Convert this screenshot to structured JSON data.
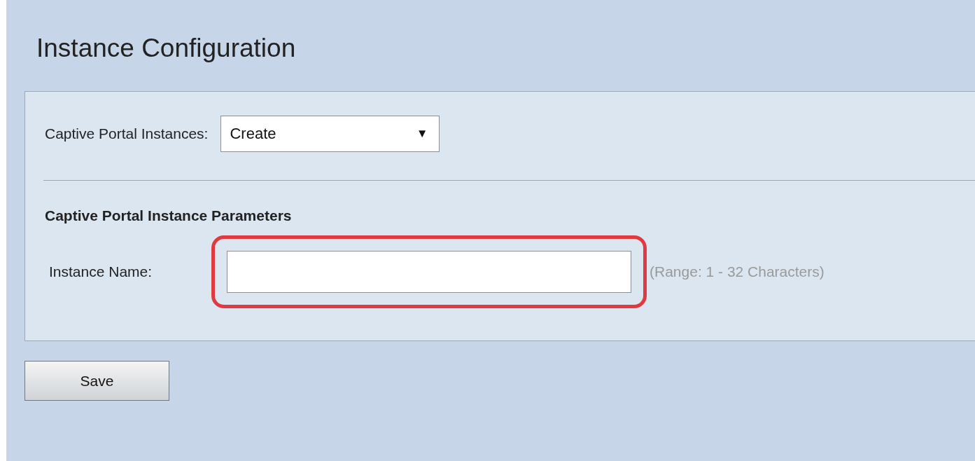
{
  "title": "Instance Configuration",
  "instances": {
    "label": "Captive Portal Instances:",
    "value": "Create",
    "arrow": "▼"
  },
  "section": {
    "heading": "Captive Portal Instance Parameters"
  },
  "instance_name": {
    "label": "Instance Name:",
    "hint": "(Range: 1 - 32 Characters)",
    "highlighted": true
  },
  "buttons": [
    {
      "label": "Save"
    }
  ]
}
